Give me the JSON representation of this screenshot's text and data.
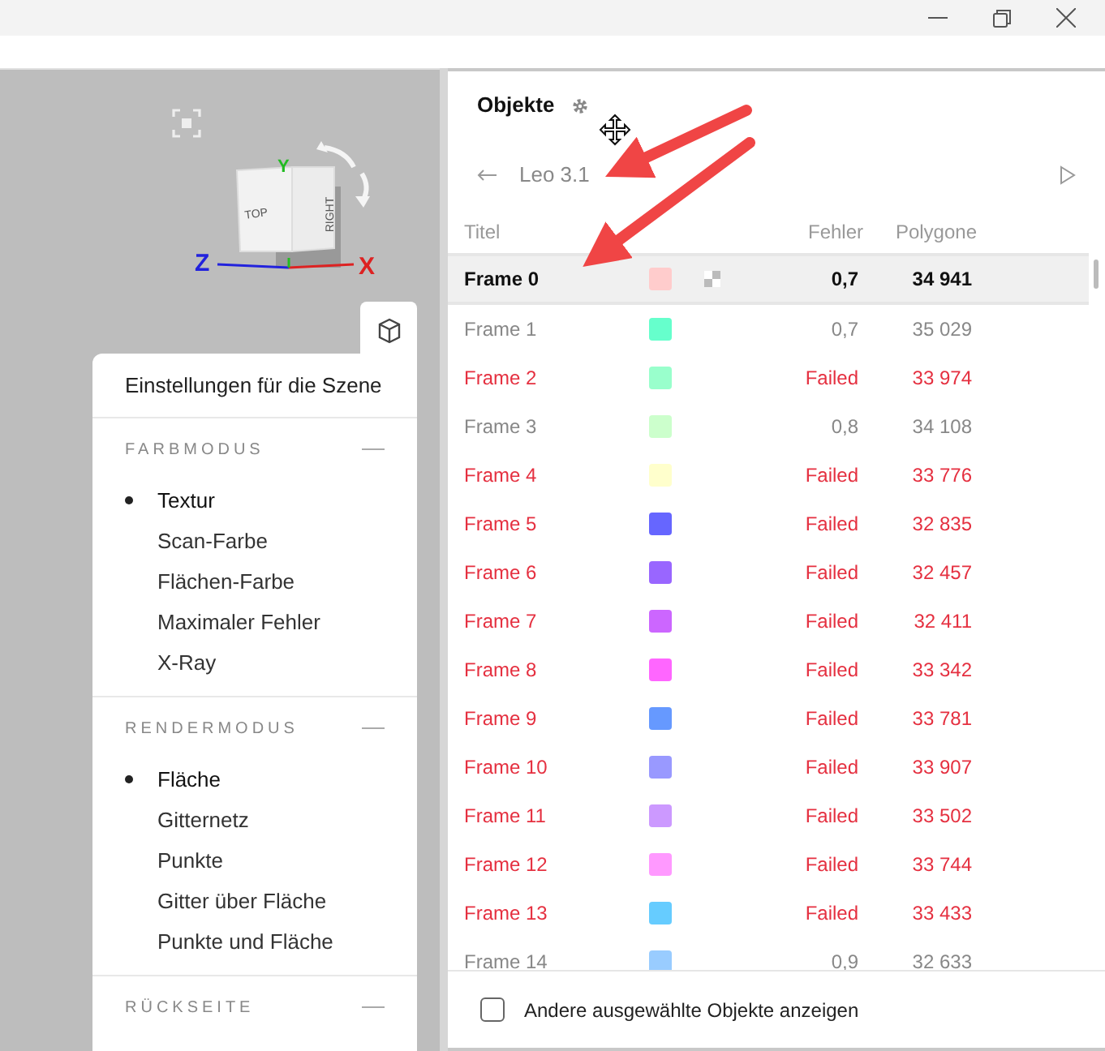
{
  "viewport": {
    "gizmo": {
      "top_label": "TOP",
      "right_label": "RIGHT",
      "x_axis": "X",
      "y_axis": "Y",
      "z_axis": "Z"
    }
  },
  "scene_settings": {
    "title": "Einstellungen für die Szene",
    "sections": [
      {
        "title": "FARBMODUS",
        "expanded": true,
        "items": [
          {
            "label": "Textur",
            "selected": true
          },
          {
            "label": "Scan-Farbe",
            "selected": false
          },
          {
            "label": "Flächen-Farbe",
            "selected": false
          },
          {
            "label": "Maximaler Fehler",
            "selected": false
          },
          {
            "label": "X-Ray",
            "selected": false
          }
        ]
      },
      {
        "title": "RENDERMODUS",
        "expanded": true,
        "items": [
          {
            "label": "Fläche",
            "selected": true
          },
          {
            "label": "Gitternetz",
            "selected": false
          },
          {
            "label": "Punkte",
            "selected": false
          },
          {
            "label": "Gitter über Fläche",
            "selected": false
          },
          {
            "label": "Punkte und Fläche",
            "selected": false
          }
        ]
      },
      {
        "title": "RÜCKSEITE",
        "expanded": true
      }
    ]
  },
  "objects_panel": {
    "title": "Objekte",
    "breadcrumb": "Leo 3.1",
    "columns": [
      "Titel",
      "Fehler",
      "Polygone"
    ],
    "rows": [
      {
        "title": "Frame 0",
        "color": "#ffcccc",
        "failed": false,
        "error": "0,7",
        "polygons": "34 941",
        "selected": true
      },
      {
        "title": "Frame 1",
        "color": "#66ffcc",
        "failed": false,
        "error": "0,7",
        "polygons": "35 029",
        "selected": false
      },
      {
        "title": "Frame 2",
        "color": "#99ffcc",
        "failed": true,
        "error": "Failed",
        "polygons": "33 974",
        "selected": false
      },
      {
        "title": "Frame 3",
        "color": "#ccffcc",
        "failed": false,
        "error": "0,8",
        "polygons": "34 108",
        "selected": false
      },
      {
        "title": "Frame 4",
        "color": "#ffffcc",
        "failed": true,
        "error": "Failed",
        "polygons": "33 776",
        "selected": false
      },
      {
        "title": "Frame 5",
        "color": "#6666ff",
        "failed": true,
        "error": "Failed",
        "polygons": "32 835",
        "selected": false
      },
      {
        "title": "Frame 6",
        "color": "#9966ff",
        "failed": true,
        "error": "Failed",
        "polygons": "32 457",
        "selected": false
      },
      {
        "title": "Frame 7",
        "color": "#cc66ff",
        "failed": true,
        "error": "Failed",
        "polygons": "32 411",
        "selected": false
      },
      {
        "title": "Frame 8",
        "color": "#ff66ff",
        "failed": true,
        "error": "Failed",
        "polygons": "33 342",
        "selected": false
      },
      {
        "title": "Frame 9",
        "color": "#6699ff",
        "failed": true,
        "error": "Failed",
        "polygons": "33 781",
        "selected": false
      },
      {
        "title": "Frame 10",
        "color": "#9999ff",
        "failed": true,
        "error": "Failed",
        "polygons": "33 907",
        "selected": false
      },
      {
        "title": "Frame 11",
        "color": "#cc99ff",
        "failed": true,
        "error": "Failed",
        "polygons": "33 502",
        "selected": false
      },
      {
        "title": "Frame 12",
        "color": "#ff99ff",
        "failed": true,
        "error": "Failed",
        "polygons": "33 744",
        "selected": false
      },
      {
        "title": "Frame 13",
        "color": "#66ccff",
        "failed": true,
        "error": "Failed",
        "polygons": "33 433",
        "selected": false
      },
      {
        "title": "Frame 14",
        "color": "#99ccff",
        "failed": false,
        "error": "0,9",
        "polygons": "32 633",
        "selected": false
      }
    ],
    "footer_checkbox": {
      "label": "Andere ausgewählte Objekte anzeigen",
      "checked": false
    }
  }
}
